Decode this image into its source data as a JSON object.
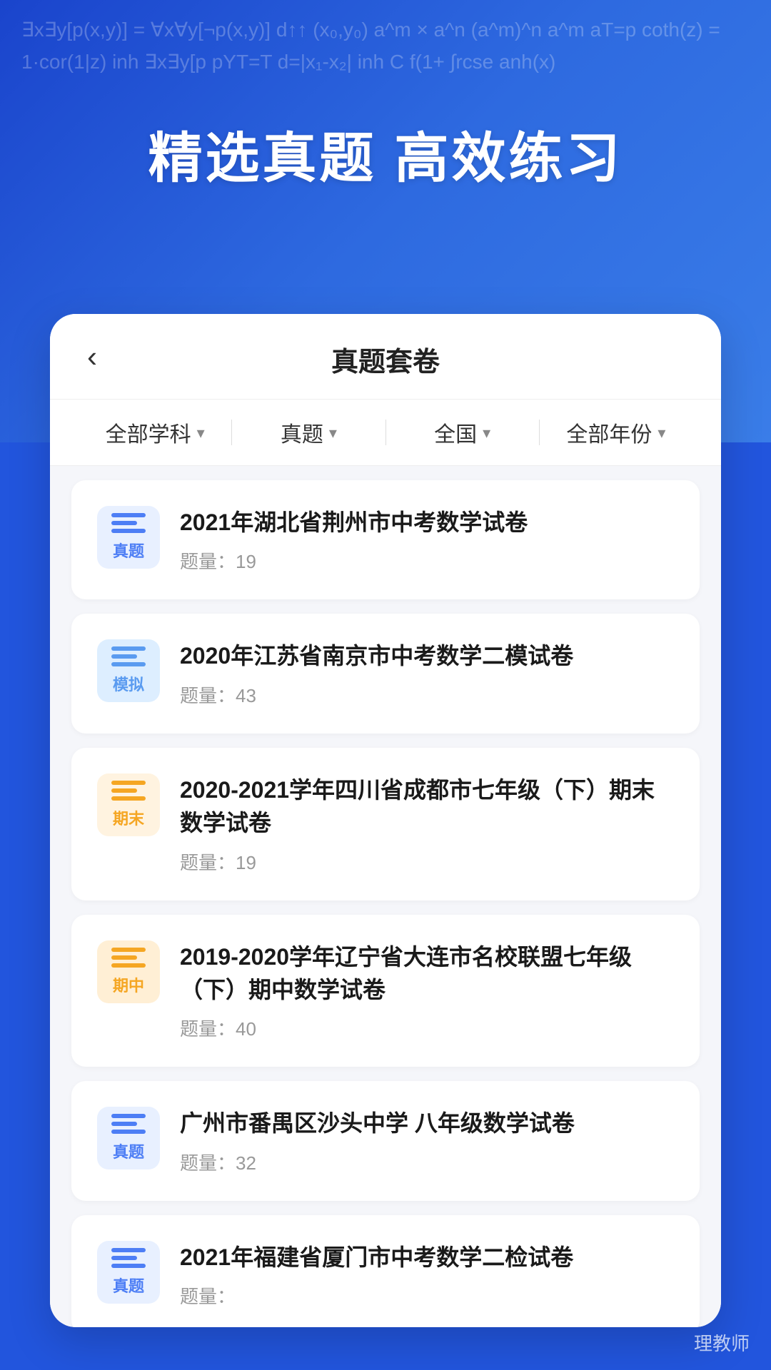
{
  "background": {
    "math_text": "∃x∃y[p(x,y)] = ∀x∀y[¬p(x,y)]    d↑↑ (x₀,y₀)\n   a^m × a^n    (a^m)^n    a^m\n  aT=p    coth(z) = 1·cor(1|z)\n  inh   ∃x∃y[p    pYT=T    d=|x₁-x₂|\n  inh C\n  f(1+    ∫rcse   \n  anh(x)   "
  },
  "hero": {
    "title": "精选真题 高效练习"
  },
  "header": {
    "back_label": "‹",
    "title": "真题套卷"
  },
  "filters": [
    {
      "label": "全部学科",
      "has_arrow": true
    },
    {
      "label": "真题",
      "has_arrow": true
    },
    {
      "label": "全国",
      "has_arrow": true
    },
    {
      "label": "全部年份",
      "has_arrow": true
    }
  ],
  "items": [
    {
      "badge_type": "zhen-ti",
      "badge_label": "真题",
      "title": "2021年湖北省荆州市中考数学试卷",
      "count_label": "题量：",
      "count": "19"
    },
    {
      "badge_type": "mo-ni",
      "badge_label": "模拟",
      "title": "2020年江苏省南京市中考数学二模试卷",
      "count_label": "题量：",
      "count": "43"
    },
    {
      "badge_type": "qi-mo",
      "badge_label": "期末",
      "title": "2020-2021学年四川省成都市七年级（下）期末数学试卷",
      "count_label": "题量：",
      "count": "19"
    },
    {
      "badge_type": "qi-zhong",
      "badge_label": "期中",
      "title": "2019-2020学年辽宁省大连市名校联盟七年级（下）期中数学试卷",
      "count_label": "题量：",
      "count": "40"
    },
    {
      "badge_type": "zhen-ti",
      "badge_label": "真题",
      "title": "广州市番禺区沙头中学 八年级数学试卷",
      "count_label": "题量：",
      "count": "32"
    },
    {
      "badge_type": "zhen-ti",
      "badge_label": "真题",
      "title": "2021年福建省厦门市中考数学二检试卷",
      "count_label": "题量：",
      "count": ""
    }
  ],
  "watermark": "理教师"
}
